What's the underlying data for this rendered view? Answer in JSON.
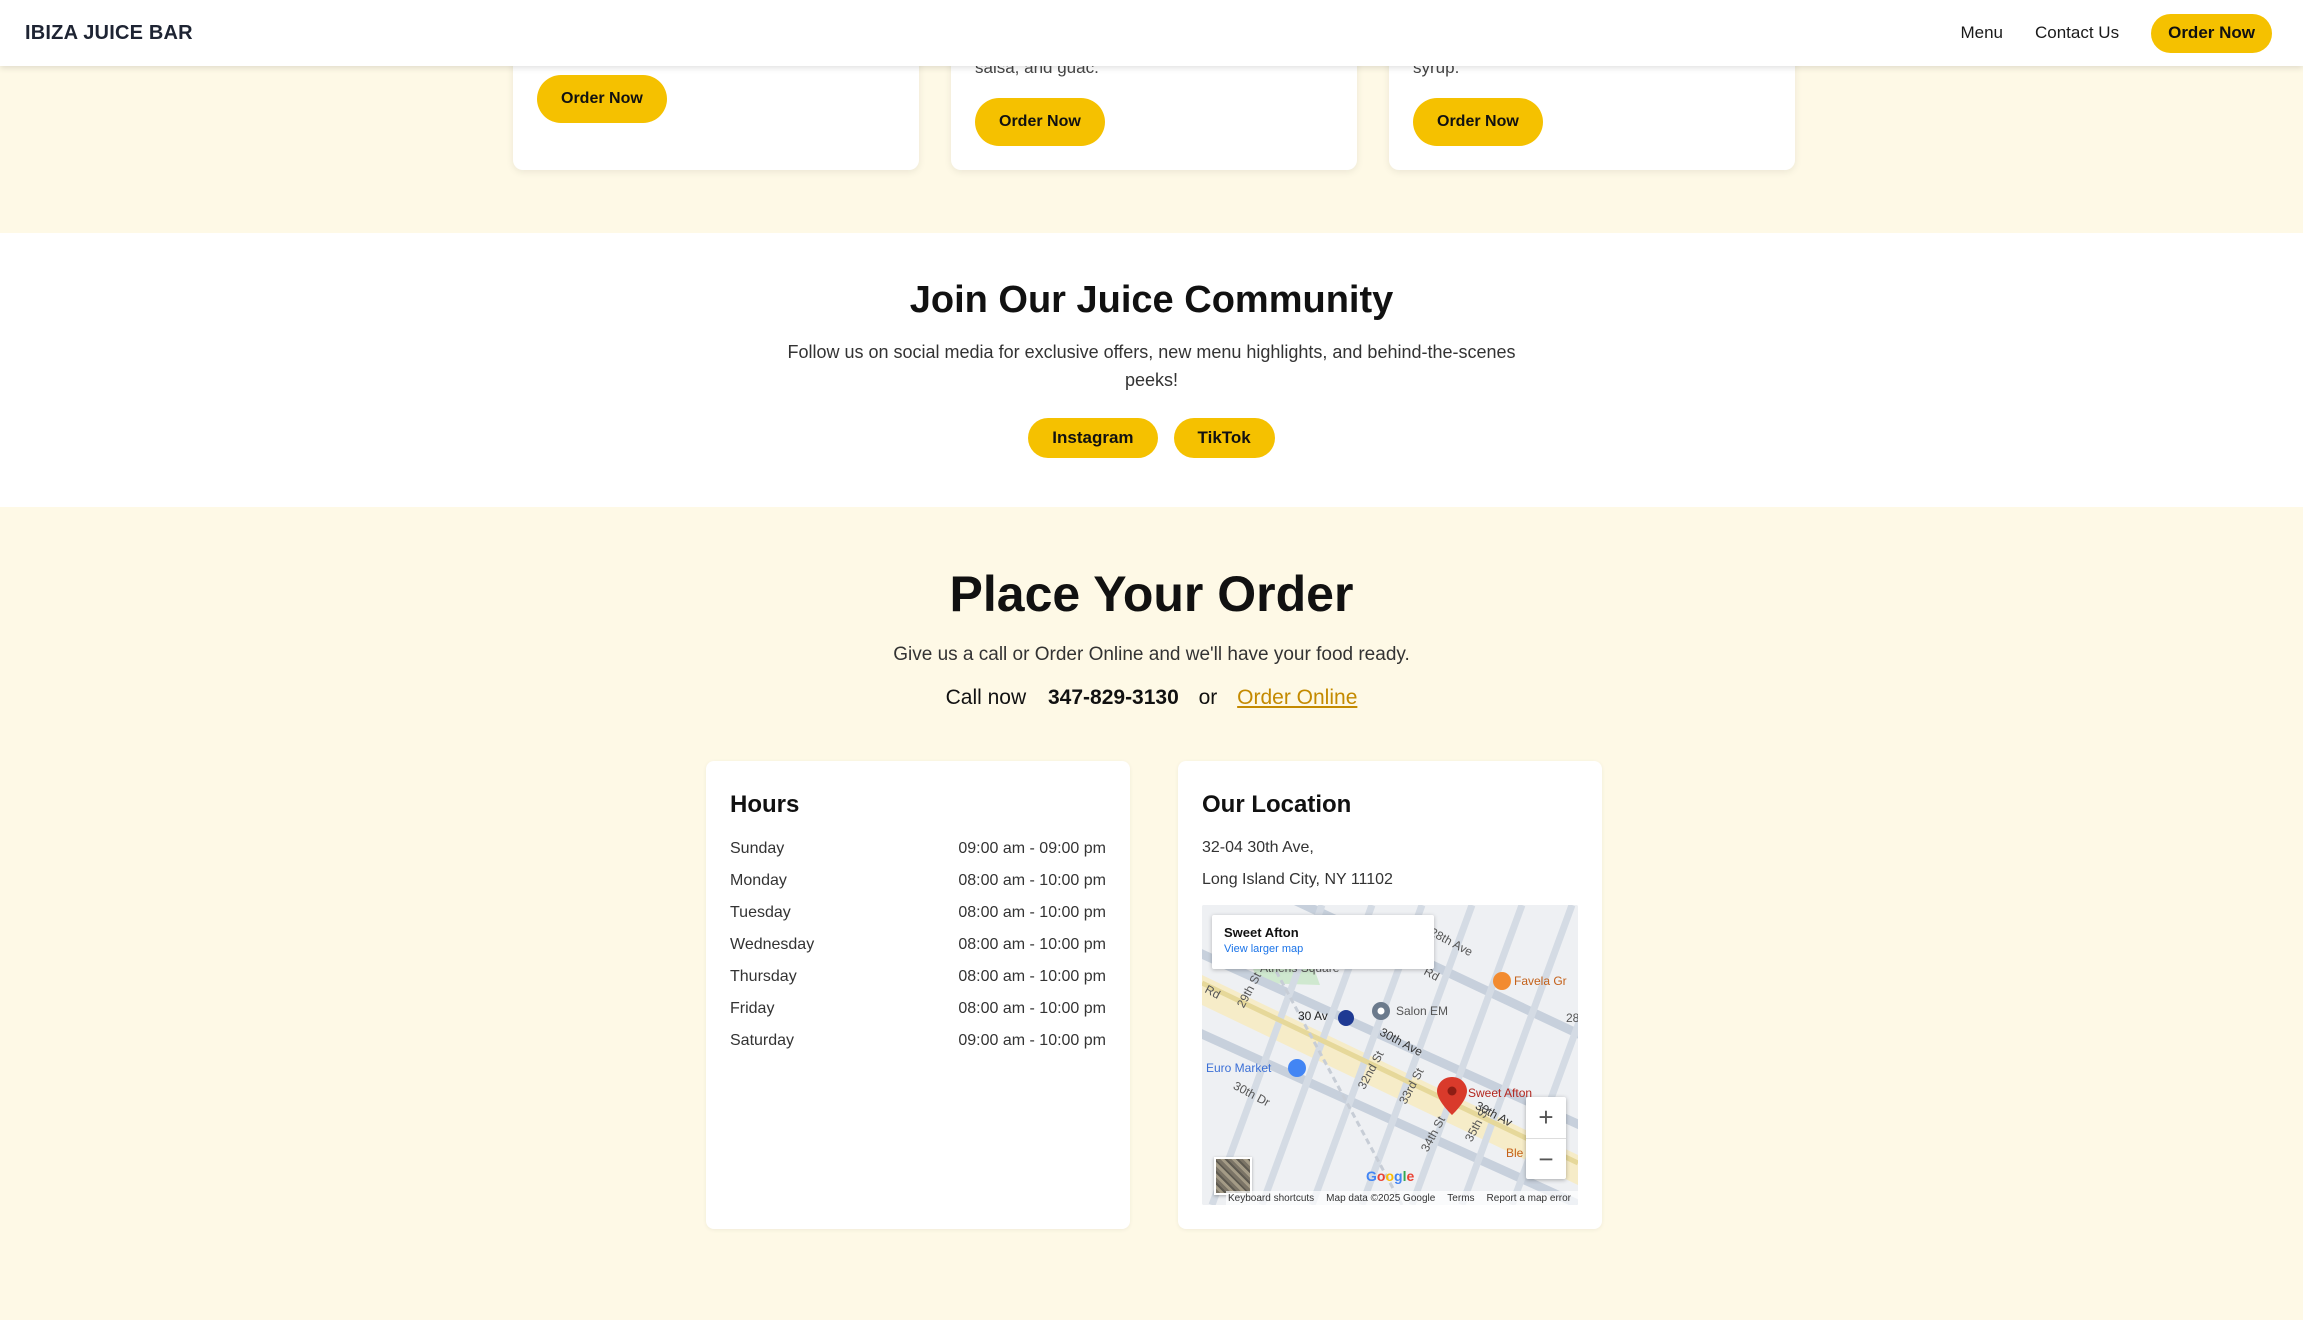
{
  "header": {
    "brand": "IBIZA JUICE BAR",
    "nav": [
      "Menu",
      "Contact Us"
    ],
    "cta": "Order Now"
  },
  "menu_cards": [
    {
      "desc": "",
      "button": "Order Now"
    },
    {
      "desc": "salsa, and guac.",
      "button": "Order Now"
    },
    {
      "desc": "syrup.",
      "button": "Order Now"
    }
  ],
  "community": {
    "title": "Join Our Juice Community",
    "text": "Follow us on social media for exclusive offers, new menu highlights, and behind-the-scenes peeks!",
    "buttons": [
      "Instagram",
      "TikTok"
    ]
  },
  "order": {
    "title": "Place Your Order",
    "subtitle": "Give us a call or Order Online and we'll have your food ready.",
    "call_label": "Call now",
    "phone": "347-829-3130",
    "or": "or",
    "online_link": "Order Online"
  },
  "hours": {
    "title": "Hours",
    "rows": [
      {
        "day": "Sunday",
        "time": "09:00 am - 09:00 pm"
      },
      {
        "day": "Monday",
        "time": "08:00 am - 10:00 pm"
      },
      {
        "day": "Tuesday",
        "time": "08:00 am - 10:00 pm"
      },
      {
        "day": "Wednesday",
        "time": "08:00 am - 10:00 pm"
      },
      {
        "day": "Thursday",
        "time": "08:00 am - 10:00 pm"
      },
      {
        "day": "Friday",
        "time": "08:00 am - 10:00 pm"
      },
      {
        "day": "Saturday",
        "time": "09:00 am - 10:00 pm"
      }
    ]
  },
  "location": {
    "title": "Our Location",
    "address_line1": "32-04 30th Ave,",
    "address_line2": "Long Island City, NY 11102",
    "map": {
      "place_name": "Sweet Afton",
      "view_larger": "View larger map",
      "labels": {
        "favela": "Favela Gr",
        "salon": "Salon EM",
        "station": "30 Av",
        "euro": "Euro Market",
        "pin": "Sweet Afton",
        "athens": "Athens Square",
        "thirtieth_ave": "30th Ave",
        "thirtieth_dr": "30th Dr",
        "thirtieth_ave_b": "30th Av",
        "twentyninth": "29th St",
        "thirtysecond": "32nd St",
        "thirtythird": "33rd St",
        "thirtyfourth": "34th St",
        "thirtyfifth": "35th St",
        "ble": "Ble",
        "rd": "Rd",
        "rd2": "Rd",
        "twentyeighth": "28th Ave",
        "twentyeight_b": "28"
      },
      "zoom_in": "+",
      "zoom_out": "−",
      "google": "Google",
      "footer": [
        "Keyboard shortcuts",
        "Map data ©2025 Google",
        "Terms",
        "Report a map error"
      ]
    }
  },
  "colors": {
    "accent": "#f5c100",
    "cream": "#fef9e6",
    "link": "#c48a00"
  }
}
